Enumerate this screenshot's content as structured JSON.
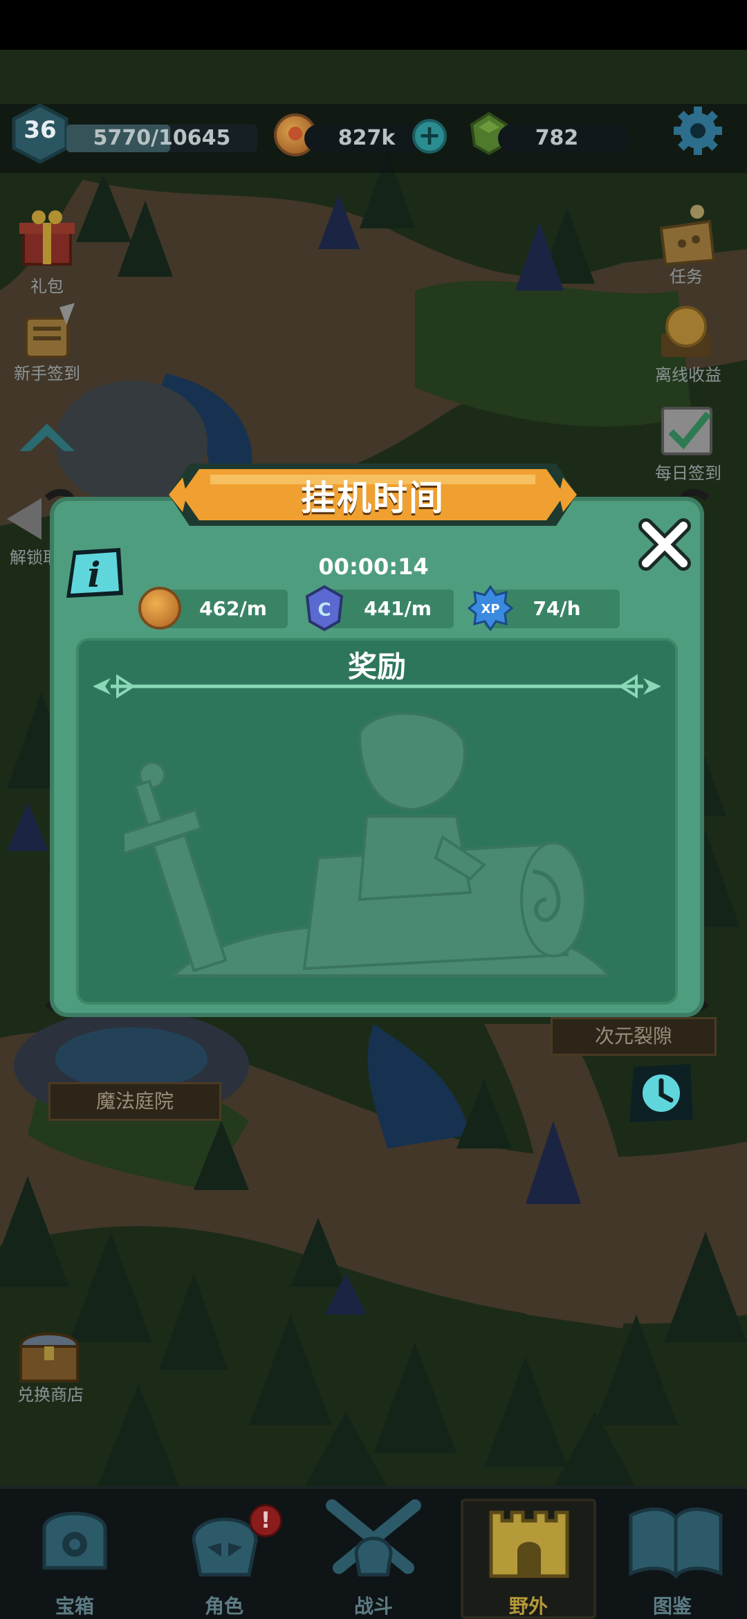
{
  "status_bar": {},
  "top_bar": {
    "level": "36",
    "xp_text": "5770/10645",
    "xp_fraction": 0.542,
    "gold": "827k",
    "gems": "782"
  },
  "left_menu": {
    "gift": "礼包",
    "newbie_checkin": "新手签到",
    "unlock_partial": "解锁耶"
  },
  "right_menu": {
    "quests": "任务",
    "offline_income": "离线收益",
    "daily_checkin": "每日签到"
  },
  "map_places": {
    "magic_courtyard": "魔法庭院",
    "rift": "次元裂隙",
    "exchange_shop": "兑换商店"
  },
  "idle_modal": {
    "title": "挂机时间",
    "timer": "00:00:14",
    "rates": [
      {
        "icon": "gold-coin-icon",
        "value": "462/m"
      },
      {
        "icon": "blue-crystal-icon",
        "value": "441/m"
      },
      {
        "icon": "xp-star-icon",
        "value": "74/h"
      }
    ],
    "rewards_title": "奖励",
    "info_symbol": "i"
  },
  "bottom_nav": {
    "items": [
      {
        "label": "宝箱",
        "icon": "chest-icon"
      },
      {
        "label": "角色",
        "icon": "helmet-icon"
      },
      {
        "label": "战斗",
        "icon": "crossed-swords-icon"
      },
      {
        "label": "野外",
        "icon": "castle-icon"
      },
      {
        "label": "图鉴",
        "icon": "book-icon"
      }
    ],
    "active_index": 3,
    "alert_symbol": "!"
  },
  "colors": {
    "modal_green": "#4f9d7f",
    "banner_orange": "#f0a030",
    "nav_inactive": "#5d7c85",
    "nav_active": "#b59a3a"
  }
}
